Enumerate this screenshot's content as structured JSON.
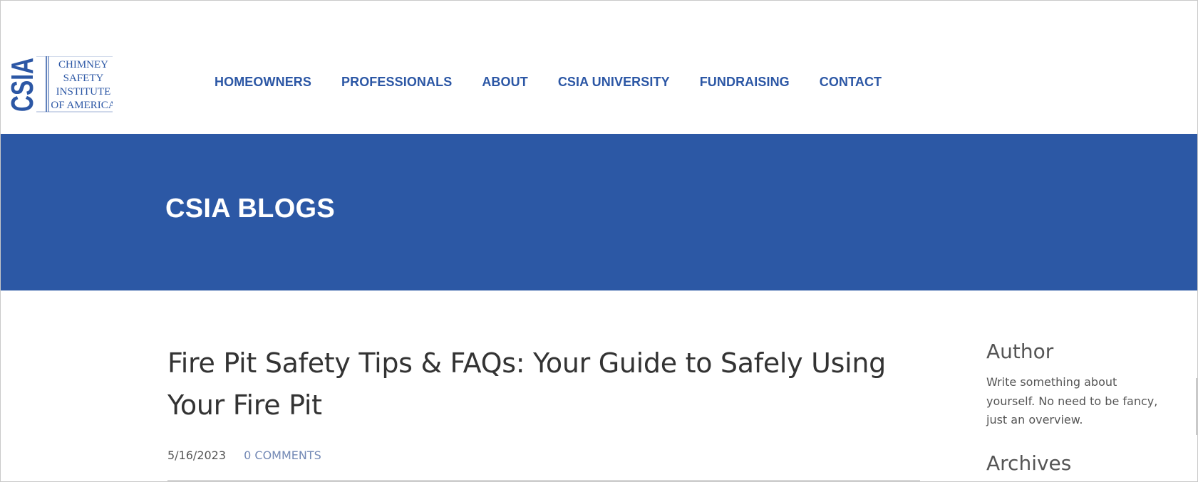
{
  "logo": {
    "monogram": "CSIA",
    "lines": [
      "CHIMNEY",
      "SAFETY",
      "INSTITUTE",
      "OF AMERICA"
    ],
    "color": "#2c57a5"
  },
  "nav": {
    "items": [
      {
        "label": "HOMEOWNERS"
      },
      {
        "label": "PROFESSIONALS"
      },
      {
        "label": "ABOUT"
      },
      {
        "label": "CSIA UNIVERSITY"
      },
      {
        "label": "FUNDRAISING"
      },
      {
        "label": "CONTACT"
      }
    ]
  },
  "banner": {
    "title": "CSIA BLOGS",
    "color": "#2c58a5"
  },
  "post": {
    "title": "Fire Pit Safety Tips & FAQs: Your Guide to Safely Using Your Fire Pit",
    "date": "5/16/2023",
    "comments": "0 COMMENTS"
  },
  "sidebar": {
    "author_heading": "Author",
    "author_text": "Write something about yourself. No need to be fancy, just an overview.",
    "archives_heading": "Archives"
  }
}
